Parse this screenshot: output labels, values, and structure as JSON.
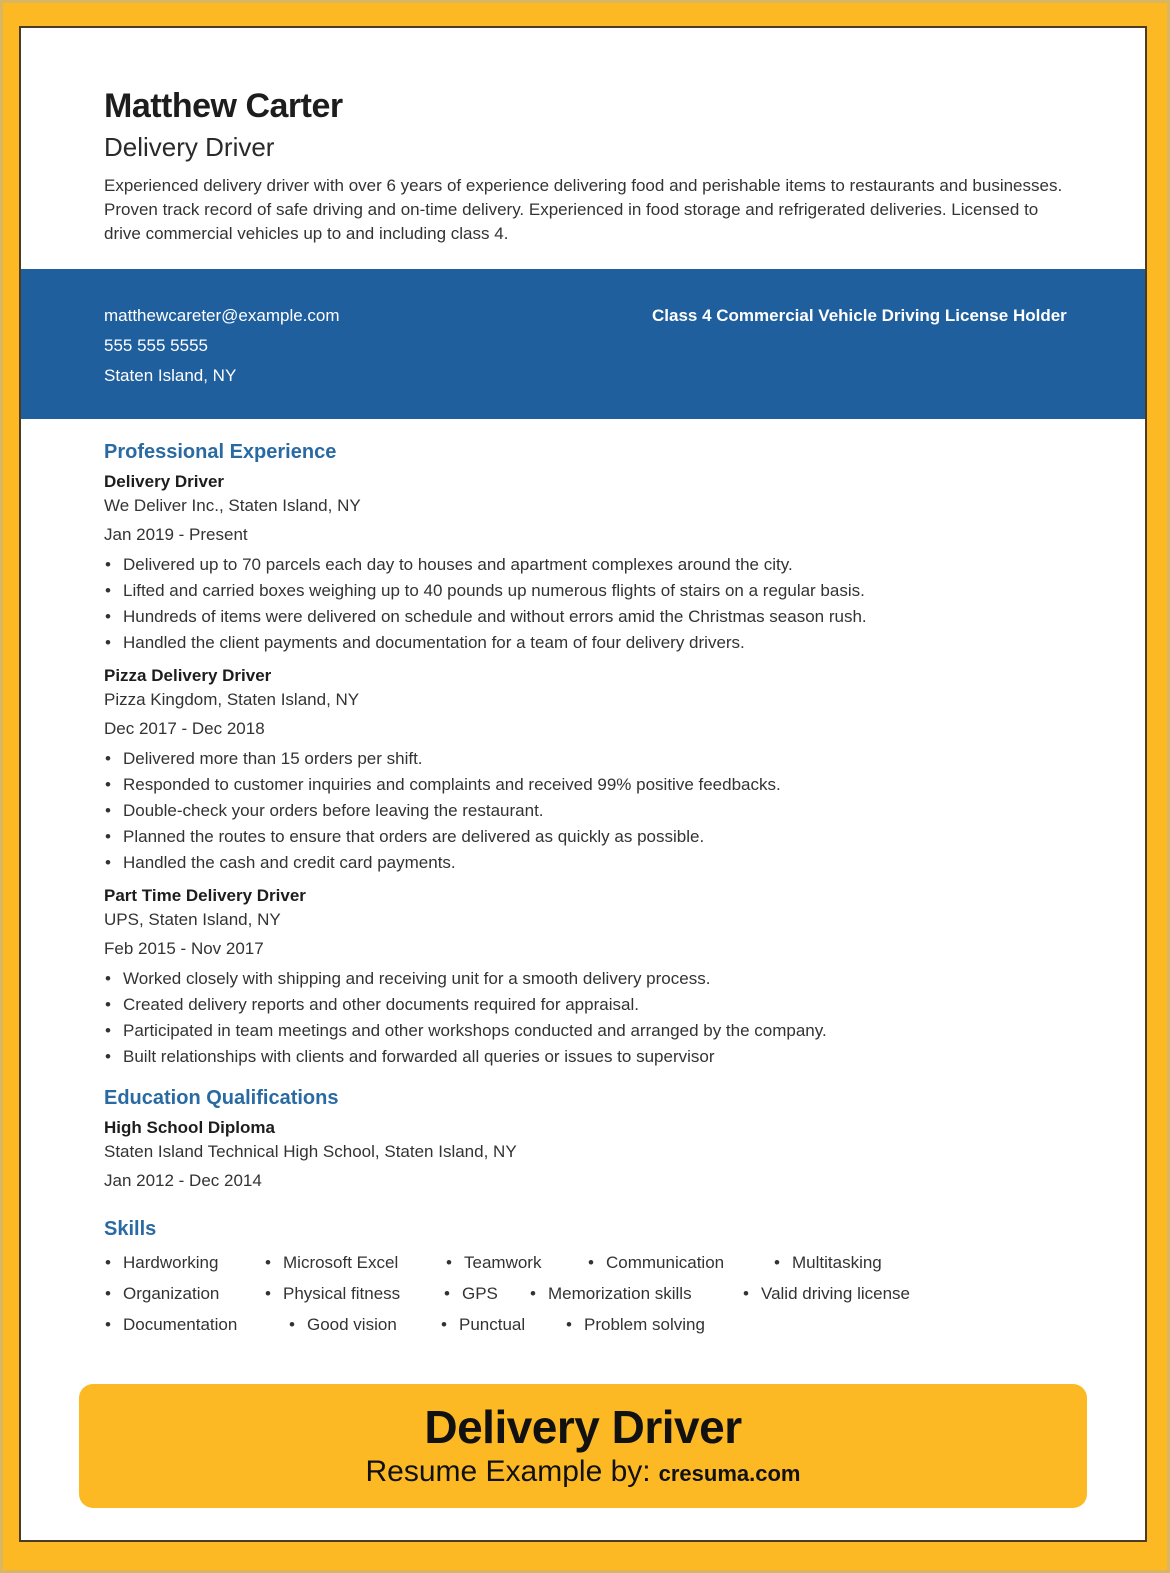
{
  "header": {
    "name": "Matthew Carter",
    "title": "Delivery Driver",
    "summary": "Experienced delivery driver with over 6 years of experience delivering food and perishable items to restaurants and businesses. Proven track record of safe driving and on-time delivery. Experienced in food storage and refrigerated deliveries. Licensed to drive commercial vehicles up to and including class 4."
  },
  "contact": {
    "email": "matthewcareter@example.com",
    "phone": "555 555 5555",
    "location": "Staten Island, NY",
    "license": "Class 4 Commercial Vehicle Driving License Holder"
  },
  "experience": {
    "heading": "Professional Experience",
    "jobs": [
      {
        "title": "Delivery Driver",
        "company": "We Deliver Inc., Staten Island, NY",
        "dates": "Jan 2019 - Present",
        "bullets": [
          "Delivered up to 70 parcels each day to houses and apartment complexes around the city.",
          "Lifted and carried boxes weighing up to 40 pounds up numerous flights of stairs on a regular basis.",
          "Hundreds of items were delivered on schedule and without errors amid the Christmas season rush.",
          "Handled the client payments and documentation for a team of four delivery drivers."
        ]
      },
      {
        "title": "Pizza Delivery Driver",
        "company": "Pizza Kingdom, Staten Island, NY",
        "dates": "Dec 2017 - Dec 2018",
        "bullets": [
          "Delivered more than 15 orders per shift.",
          "Responded to customer inquiries and complaints and received 99% positive feedbacks.",
          "Double-check your orders before leaving the restaurant.",
          "Planned the routes to ensure that orders are delivered as quickly as possible.",
          "Handled the cash and credit card payments."
        ]
      },
      {
        "title": "Part Time Delivery Driver",
        "company": "UPS, Staten Island, NY",
        "dates": "Feb 2015 - Nov 2017",
        "bullets": [
          "Worked closely with shipping and receiving unit for a smooth delivery process.",
          "Created delivery reports and other documents required for appraisal.",
          "Participated in team meetings and other workshops conducted and arranged by the company.",
          "Built relationships with clients and forwarded all queries or issues to supervisor"
        ]
      }
    ]
  },
  "education": {
    "heading": "Education Qualifications",
    "degree": "High School Diploma",
    "school": "Staten Island Technical High School, Staten Island, NY",
    "dates": "Jan 2012 - Dec 2014"
  },
  "skills": {
    "heading": "Skills",
    "rows": [
      [
        "Hardworking",
        "Microsoft Excel",
        "Teamwork",
        "Communication",
        "Multitasking"
      ],
      [
        "Organization",
        "Physical fitness",
        "GPS",
        "Memorization skills",
        "Valid driving license"
      ],
      [
        "Documentation",
        "Good vision",
        "Punctual",
        "Problem solving"
      ]
    ]
  },
  "banner": {
    "title": "Delivery Driver",
    "subtitle": "Resume Example by:",
    "site": "cresuma.com"
  },
  "colors": {
    "frame": "#fdb924",
    "band": "#1f5f9e",
    "heading": "#2a6aa3"
  }
}
